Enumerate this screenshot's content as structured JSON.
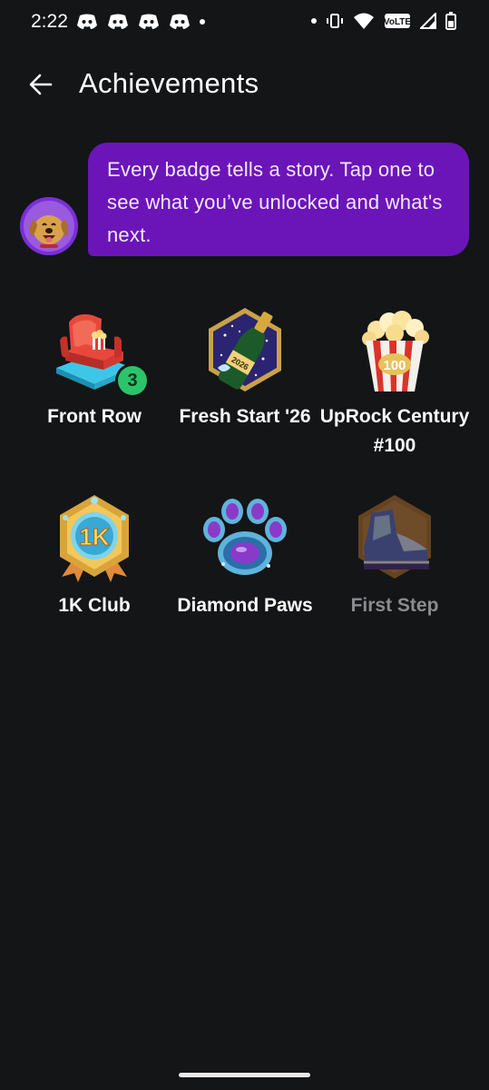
{
  "status_bar": {
    "time": "2:22",
    "notification_icons": [
      "discord-icon",
      "discord-icon",
      "discord-icon",
      "discord-icon"
    ],
    "network_label": "VoLTE"
  },
  "header": {
    "title": "Achievements"
  },
  "intro": {
    "message": "Every badge tells a story. Tap one to see what you’ve unlocked and what's next."
  },
  "badges": [
    {
      "label": "Front Row",
      "icon": "cinema-seat-icon",
      "count": "3",
      "locked": false
    },
    {
      "label": "Fresh Start '26",
      "icon": "champagne-2026-icon",
      "locked": false
    },
    {
      "label": "UpRock Century #100",
      "icon": "popcorn-100-icon",
      "locked": false
    },
    {
      "label": "1K Club",
      "icon": "1k-shield-icon",
      "locked": false
    },
    {
      "label": "Diamond Paws",
      "icon": "diamond-paw-icon",
      "locked": false
    },
    {
      "label": "First Step",
      "icon": "sneaker-icon",
      "locked": true
    }
  ],
  "colors": {
    "background": "#141517",
    "bubble": "#6b15b9",
    "count_badge": "#2cc46a",
    "locked_label": "#8b8c8f"
  }
}
